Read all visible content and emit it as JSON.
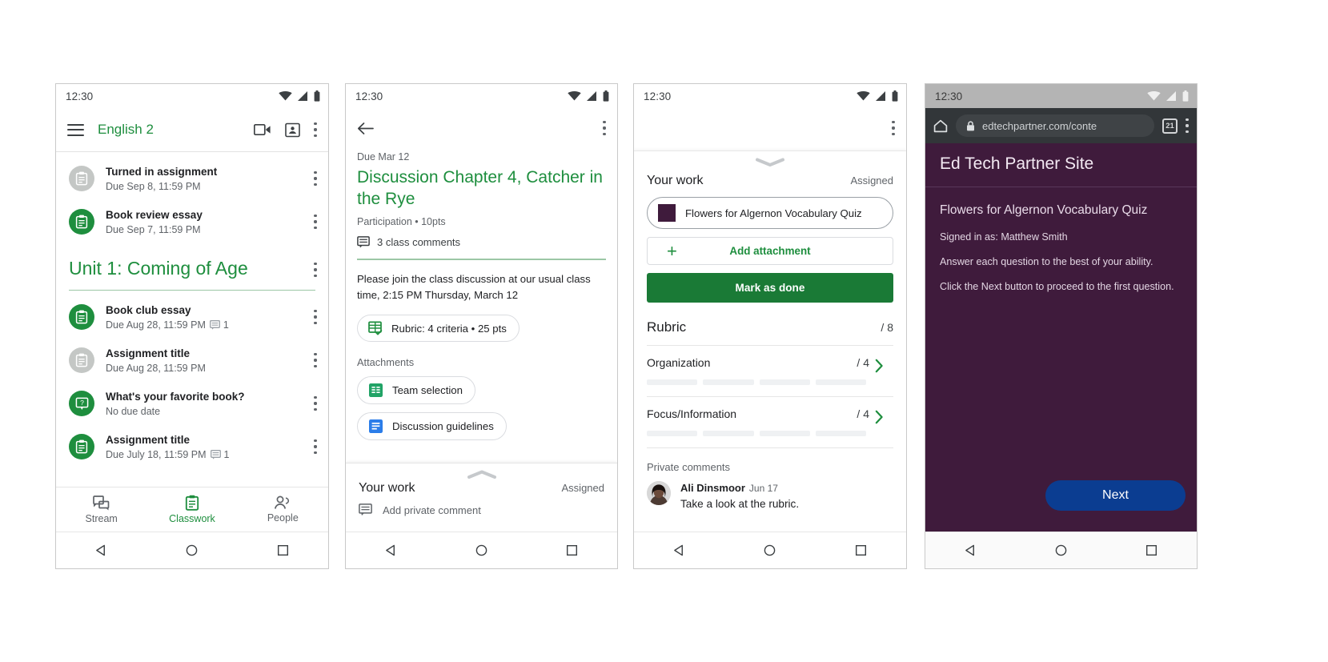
{
  "phone1": {
    "status": {
      "time": "12:30",
      "icons": [
        "wifi-icon",
        "signal-icon",
        "battery-icon"
      ]
    },
    "appbar": {
      "menu_icon": "hamburger-menu-icon",
      "title": "English 2",
      "video_icon": "video-call-icon",
      "id_icon": "class-card-icon",
      "more_icon": "more-options-icon"
    },
    "top_items": [
      {
        "title": "Turned in assignment",
        "subtitle": "Due Sep 8, 11:59 PM",
        "icon": "assignment-icon",
        "state": "grey",
        "comments": ""
      },
      {
        "title": "Book review essay",
        "subtitle": "Due Sep 7, 11:59 PM",
        "icon": "assignment-icon",
        "state": "green",
        "comments": ""
      }
    ],
    "unit": {
      "title": "Unit 1: Coming of Age",
      "more_icon": "more-options-icon"
    },
    "unit_items": [
      {
        "title": "Book club essay",
        "subtitle": "Due Aug 28, 11:59 PM",
        "icon": "assignment-icon",
        "state": "green",
        "comments": "1"
      },
      {
        "title": "Assignment title",
        "subtitle": "Due Aug 28, 11:59 PM",
        "icon": "assignment-icon",
        "state": "grey",
        "comments": ""
      },
      {
        "title": "What's your favorite book?",
        "subtitle": "No due date",
        "icon": "question-icon",
        "state": "green",
        "comments": ""
      },
      {
        "title": "Assignment title",
        "subtitle": "Due July 18, 11:59 PM",
        "icon": "assignment-icon",
        "state": "green",
        "comments": "1"
      }
    ],
    "tabs": [
      {
        "label": "Stream",
        "icon": "stream-icon",
        "active": false
      },
      {
        "label": "Classwork",
        "icon": "classwork-icon",
        "active": true
      },
      {
        "label": "People",
        "icon": "people-icon",
        "active": false
      }
    ],
    "nav": [
      "back-icon",
      "home-icon",
      "recents-icon"
    ]
  },
  "phone2": {
    "status": {
      "time": "12:30"
    },
    "back_icon": "back-arrow-icon",
    "more_icon": "more-options-icon",
    "due": "Due Mar 12",
    "title": "Discussion Chapter 4, Catcher in the Rye",
    "meta": "Participation • 10pts",
    "comments": {
      "icon": "comment-icon",
      "label": "3 class comments"
    },
    "body": "Please join the class discussion at our usual class time, 2:15 PM Thursday, March 12",
    "rubric_chip": {
      "icon": "rubric-icon",
      "label": "Rubric: 4 criteria • 25 pts"
    },
    "attachments_label": "Attachments",
    "attachments": [
      {
        "icon": "google-sheets-icon",
        "label": "Team selection"
      },
      {
        "icon": "google-docs-icon",
        "label": "Discussion guidelines"
      }
    ],
    "sheet": {
      "chevron_icon": "chevron-up-icon",
      "title": "Your work",
      "status": "Assigned",
      "private_comment_icon": "comment-icon",
      "private_comment_placeholder": "Add private comment"
    },
    "nav": [
      "back-icon",
      "home-icon",
      "recents-icon"
    ]
  },
  "phone3": {
    "status": {
      "time": "12:30"
    },
    "more_icon": "more-options-icon",
    "chevron_icon": "chevron-down-icon",
    "your_work": {
      "title": "Your work",
      "status": "Assigned"
    },
    "attachment": {
      "thumb": "quiz-thumbnail",
      "label": "Flowers for Algernon Vocabulary Quiz"
    },
    "add_attachment": {
      "icon": "plus-icon",
      "label": "Add attachment"
    },
    "mark_done": "Mark as done",
    "rubric": {
      "title": "Rubric",
      "total": "/ 8"
    },
    "criteria": [
      {
        "name": "Organization",
        "score": "/ 4",
        "chevron": "chevron-right-icon",
        "levels": 4
      },
      {
        "name": "Focus/Information",
        "score": "/ 4",
        "chevron": "chevron-right-icon",
        "levels": 4
      }
    ],
    "private_comments": {
      "header": "Private comments",
      "author": "Ali Dinsmoor",
      "date": "Jun 17",
      "text": "Take a look at the rubric.",
      "avatar": "user-avatar"
    },
    "nav": [
      "back-icon",
      "home-icon",
      "recents-icon"
    ]
  },
  "phone4": {
    "status": {
      "time": "12:30"
    },
    "chrome": {
      "home_icon": "home-icon",
      "lock_icon": "lock-icon",
      "url": "edtechpartner.com/conte",
      "tab_count": "21",
      "menu_icon": "more-options-icon"
    },
    "site_title": "Ed Tech Partner Site",
    "quiz_title": "Flowers for Algernon Vocabulary Quiz",
    "lines": [
      "Signed in as: Matthew Smith",
      "Answer each question to the best of your ability.",
      "Click the Next button to proceed to the first question."
    ],
    "next_button": "Next",
    "nav": [
      "back-icon",
      "home-icon",
      "recents-icon"
    ]
  },
  "colors": {
    "classroom_green": "#1e8e3e",
    "mark_done_green": "#1a7a36",
    "site_purple": "#3f1b3c",
    "next_blue": "#0b3d91",
    "grey_avatar": "#c4c7c5"
  }
}
